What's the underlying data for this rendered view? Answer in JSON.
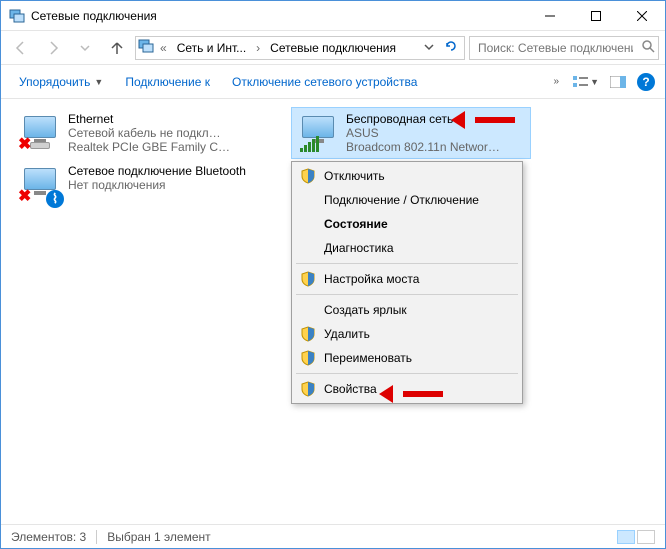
{
  "window": {
    "title": "Сетевые подключения"
  },
  "nav": {
    "crumb1": "Сеть и Инт...",
    "crumb2": "Сетевые подключения",
    "search_placeholder": "Поиск: Сетевые подключения"
  },
  "toolbar": {
    "organize": "Упорядочить",
    "connect_to": "Подключение к",
    "disable_device": "Отключение сетевого устройства"
  },
  "connections": {
    "ethernet": {
      "name": "Ethernet",
      "status": "Сетевой кабель не подкл…",
      "device": "Realtek PCIe GBE Family C…"
    },
    "bluetooth": {
      "name": "Сетевое подключение Bluetooth",
      "status": "Нет подключения",
      "device": ""
    },
    "wifi": {
      "name": "Беспроводная сеть",
      "status": "ASUS",
      "device": "Broadcom 802.11n Networ…"
    }
  },
  "context_menu": {
    "disable": "Отключить",
    "connect_disconnect": "Подключение / Отключение",
    "status": "Состояние",
    "diagnostics": "Диагностика",
    "bridge": "Настройка моста",
    "shortcut": "Создать ярлык",
    "delete": "Удалить",
    "rename": "Переименовать",
    "properties": "Свойства"
  },
  "statusbar": {
    "elements": "Элементов: 3",
    "selected": "Выбран 1 элемент"
  }
}
